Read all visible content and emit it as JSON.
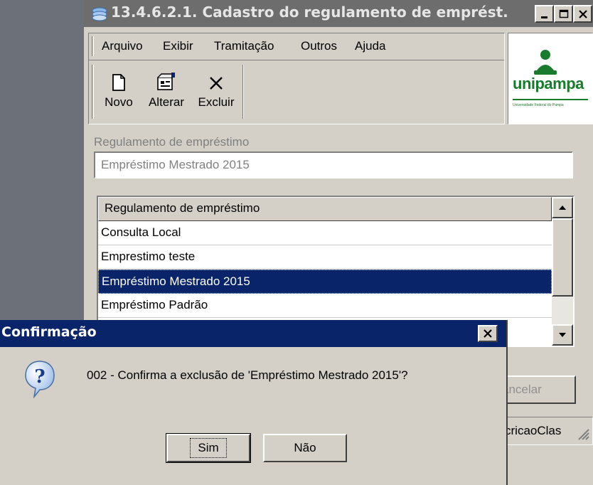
{
  "window": {
    "title": "13.4.6.2.1. Cadastro do regulamento de emprést...",
    "controls": [
      "minimize",
      "maximize",
      "close"
    ]
  },
  "menu": {
    "items": [
      {
        "label": "Arquivo",
        "accel": "A"
      },
      {
        "label": "Exibir",
        "accel": "x"
      },
      {
        "label": "Tramitação",
        "accel": ""
      },
      {
        "label": "Outros",
        "accel": ""
      },
      {
        "label": "Ajuda",
        "accel": "u"
      }
    ]
  },
  "toolbar": {
    "novo": {
      "label": "Novo",
      "icon": "new-document-icon"
    },
    "alterar": {
      "label": "Alterar",
      "icon": "edit-properties-icon"
    },
    "excluir": {
      "label": "Excluir",
      "icon": "delete-x-icon"
    }
  },
  "logo": {
    "name": "unipampa",
    "tagline": "Universidade Federal do Pampa",
    "color": "#1a7a2e"
  },
  "form": {
    "label": "Regulamento de empréstimo",
    "value": "Empréstimo Mestrado 2015"
  },
  "list": {
    "header": "Regulamento de empréstimo",
    "rows": [
      "Consulta Local",
      "Emprestimo teste",
      "Empréstimo Mestrado 2015",
      "Empréstimo Padrão"
    ],
    "selected_index": 2
  },
  "background": {
    "cancel_label": "ancelar",
    "status_text": "cricaoClas"
  },
  "dialog": {
    "title": "Confirmação",
    "message": "002 - Confirma a exclusão de 'Empréstimo Mestrado 2015'?",
    "sim_label": "Sim",
    "nao_label": "Não",
    "sim_accel": "S",
    "nao_accel": "N"
  },
  "colors": {
    "title_inactive": "#6d6d6d",
    "title_active": "#0a246a",
    "selection": "#0a246a",
    "face": "#d4d0c8"
  }
}
